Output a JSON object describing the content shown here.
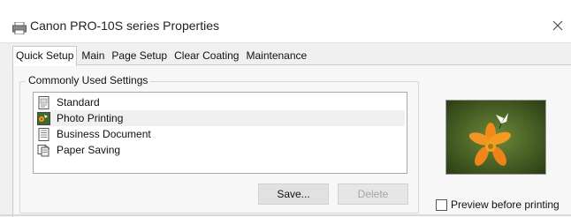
{
  "window": {
    "title": "Canon PRO-10S series Properties",
    "icon": "printer-icon",
    "close_icon": "close-icon"
  },
  "tabs": [
    {
      "label": "Quick Setup",
      "active": true
    },
    {
      "label": "Main",
      "active": false
    },
    {
      "label": "Page Setup",
      "active": false
    },
    {
      "label": "Clear Coating",
      "active": false
    },
    {
      "label": "Maintenance",
      "active": false
    }
  ],
  "commonly_used": {
    "label": "Commonly Used Settings",
    "items": [
      {
        "label": "Standard",
        "icon": "standard-settings-icon",
        "selected": false
      },
      {
        "label": "Photo Printing",
        "icon": "photo-printing-icon",
        "selected": true
      },
      {
        "label": "Business Document",
        "icon": "business-document-icon",
        "selected": false
      },
      {
        "label": "Paper Saving",
        "icon": "paper-saving-icon",
        "selected": false
      }
    ],
    "save_label": "Save...",
    "delete_label": "Delete"
  },
  "preview": {
    "image": "flower-photo-preview",
    "checkbox_label": "Preview before printing",
    "checked": false
  },
  "colors": {
    "title_bg": "#ffffff",
    "panel_bg": "#f7f7f7",
    "selected_row": "#f0f0f0",
    "flower_orange": "#f18a1a",
    "photo_green": "#3f5a20"
  }
}
